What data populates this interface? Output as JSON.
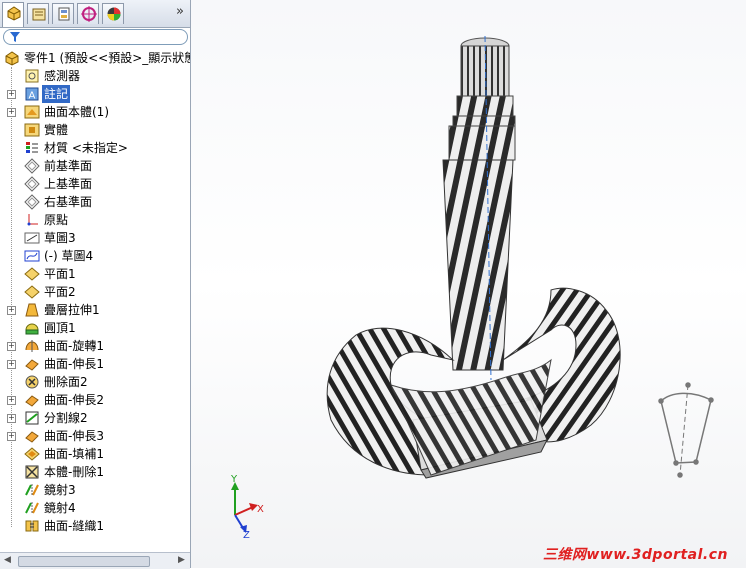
{
  "tree": {
    "root": "零件1 (預設<<預設>_顯示狀態",
    "items": [
      {
        "label": "感測器",
        "icon": "sensor-icon",
        "expander": false
      },
      {
        "label": "註記",
        "icon": "annotation-icon",
        "expander": true,
        "selected": true
      },
      {
        "label": "曲面本體(1)",
        "icon": "surface-bodies-icon",
        "expander": true
      },
      {
        "label": "實體",
        "icon": "solid-bodies-icon",
        "expander": false
      },
      {
        "label": "材質 <未指定>",
        "icon": "material-icon",
        "expander": false
      },
      {
        "label": "前基準面",
        "icon": "plane-icon",
        "expander": false
      },
      {
        "label": "上基準面",
        "icon": "plane-icon",
        "expander": false
      },
      {
        "label": "右基準面",
        "icon": "plane-icon",
        "expander": false
      },
      {
        "label": "原點",
        "icon": "origin-icon",
        "expander": false
      },
      {
        "label": "草圖3",
        "icon": "sketch-icon",
        "expander": false
      },
      {
        "label": "(-) 草圖4",
        "icon": "sketch-3d-icon",
        "expander": false
      },
      {
        "label": "平面1",
        "icon": "ref-plane-icon",
        "expander": false
      },
      {
        "label": "平面2",
        "icon": "ref-plane-icon",
        "expander": false
      },
      {
        "label": "疊層拉伸1",
        "icon": "loft-icon",
        "expander": true
      },
      {
        "label": "圓頂1",
        "icon": "dome-icon",
        "expander": false
      },
      {
        "label": "曲面-旋轉1",
        "icon": "surface-revolve-icon",
        "expander": true
      },
      {
        "label": "曲面-伸長1",
        "icon": "surface-extrude-icon",
        "expander": true
      },
      {
        "label": "刪除面2",
        "icon": "delete-face-icon",
        "expander": false
      },
      {
        "label": "曲面-伸長2",
        "icon": "surface-extrude-icon",
        "expander": true
      },
      {
        "label": "分割線2",
        "icon": "split-line-icon",
        "expander": true
      },
      {
        "label": "曲面-伸長3",
        "icon": "surface-extrude-icon",
        "expander": true
      },
      {
        "label": "曲面-填補1",
        "icon": "surface-fill-icon",
        "expander": false
      },
      {
        "label": "本體-刪除1",
        "icon": "delete-body-icon",
        "expander": false
      },
      {
        "label": "鏡射3",
        "icon": "mirror-icon",
        "expander": false
      },
      {
        "label": "鏡射4",
        "icon": "mirror-icon",
        "expander": false
      },
      {
        "label": "曲面-縫織1",
        "icon": "surface-knit-icon",
        "expander": false
      }
    ]
  },
  "tabs": [
    "feature-manager-tab",
    "property-manager-tab",
    "configuration-manager-tab",
    "dimxpert-tab",
    "display-manager-tab"
  ],
  "triad": {
    "x": "X",
    "y": "Y",
    "z": "Z"
  },
  "watermark": "三维网www.3dportal.cn",
  "colors": {
    "selection": "#3169c6",
    "triad_x": "#d02020",
    "triad_y": "#20a020",
    "triad_z": "#2040d0",
    "watermark": "#e02020"
  }
}
